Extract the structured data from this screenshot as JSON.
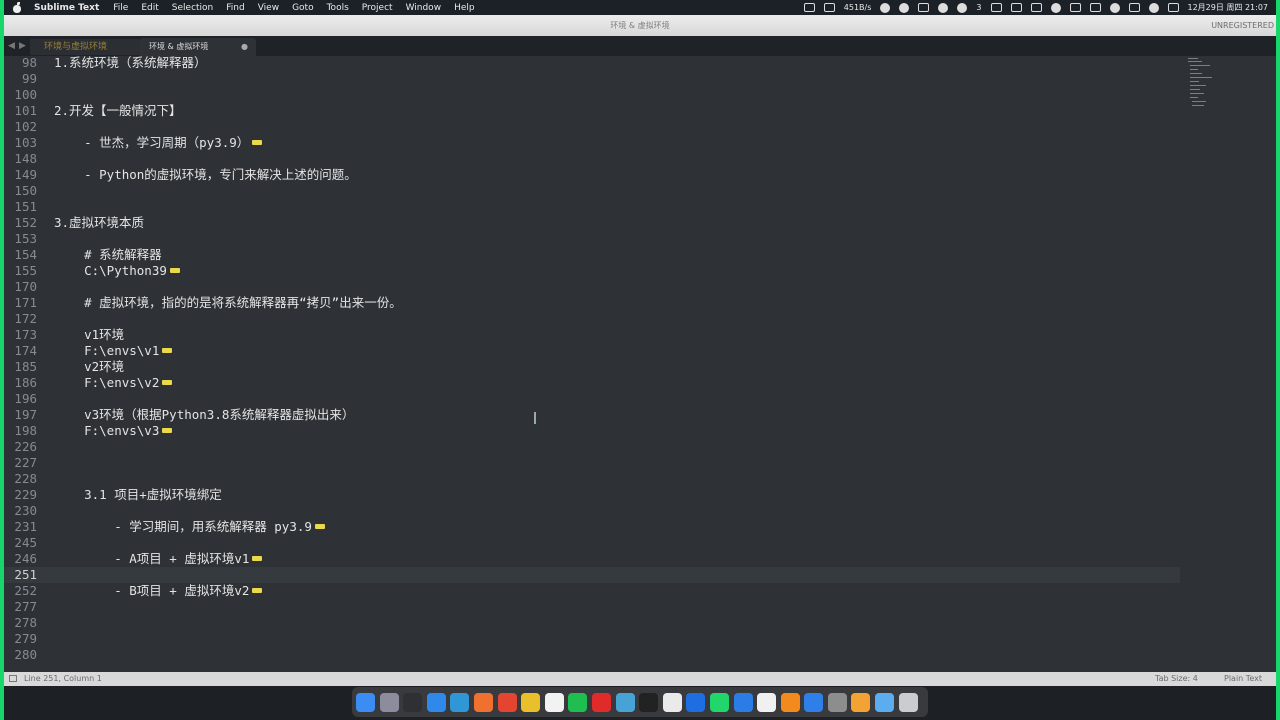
{
  "menubar": {
    "app_name": "Sublime Text",
    "items": [
      "File",
      "Edit",
      "Selection",
      "Find",
      "View",
      "Goto",
      "Tools",
      "Project",
      "Window",
      "Help"
    ],
    "status_speed": "451B/s",
    "badge_count": "3",
    "datetime": "12月29日 周四 21:07"
  },
  "window": {
    "title": "环境 & 虚拟环境",
    "unregistered": "UNREGISTERED"
  },
  "tabs": {
    "ghost_label": "环境与虚拟环境",
    "active_label": "环境 & 虚拟环境",
    "close_glyph": "●"
  },
  "editor": {
    "lines": [
      {
        "n": "98",
        "text": "1.系统环境（系统解释器）"
      },
      {
        "n": "99",
        "text": ""
      },
      {
        "n": "100",
        "text": ""
      },
      {
        "n": "101",
        "text": "2.开发【一般情况下】"
      },
      {
        "n": "102",
        "text": ""
      },
      {
        "n": "103",
        "text": "    - 世杰，学习周期（py3.9）",
        "fold": true
      },
      {
        "n": "148",
        "text": ""
      },
      {
        "n": "149",
        "text": "    - Python的虚拟环境，专门来解决上述的问题。"
      },
      {
        "n": "150",
        "text": ""
      },
      {
        "n": "151",
        "text": ""
      },
      {
        "n": "152",
        "text": "3.虚拟环境本质"
      },
      {
        "n": "153",
        "text": ""
      },
      {
        "n": "154",
        "text": "    # 系统解释器"
      },
      {
        "n": "155",
        "text": "    C:\\Python39",
        "fold": true
      },
      {
        "n": "170",
        "text": ""
      },
      {
        "n": "171",
        "text": "    # 虚拟环境，指的的是将系统解释器再“拷贝”出来一份。"
      },
      {
        "n": "172",
        "text": ""
      },
      {
        "n": "173",
        "text": "    v1环境"
      },
      {
        "n": "174",
        "text": "    F:\\envs\\v1",
        "fold": true
      },
      {
        "n": "185",
        "text": "    v2环境"
      },
      {
        "n": "186",
        "text": "    F:\\envs\\v2",
        "fold": true
      },
      {
        "n": "196",
        "text": ""
      },
      {
        "n": "197",
        "text": "    v3环境（根据Python3.8系统解释器虚拟出来）"
      },
      {
        "n": "198",
        "text": "    F:\\envs\\v3",
        "fold": true
      },
      {
        "n": "226",
        "text": ""
      },
      {
        "n": "227",
        "text": ""
      },
      {
        "n": "228",
        "text": ""
      },
      {
        "n": "229",
        "text": "    3.1 项目+虚拟环境绑定"
      },
      {
        "n": "230",
        "text": ""
      },
      {
        "n": "231",
        "text": "        - 学习期间，用系统解释器 py3.9",
        "fold": true
      },
      {
        "n": "245",
        "text": ""
      },
      {
        "n": "246",
        "text": "        - A项目 + 虚拟环境v1",
        "fold": true
      },
      {
        "n": "251",
        "text": "",
        "current": true
      },
      {
        "n": "252",
        "text": "        - B项目 + 虚拟环境v2",
        "fold": true
      },
      {
        "n": "277",
        "text": ""
      },
      {
        "n": "278",
        "text": ""
      },
      {
        "n": "279",
        "text": ""
      },
      {
        "n": "280",
        "text": ""
      }
    ]
  },
  "status": {
    "position": "Line 251, Column 1",
    "tab_size": "Tab Size: 4",
    "syntax": "Plain Text"
  },
  "dock": {
    "icons": [
      {
        "name": "finder",
        "color": "#3b8cf3"
      },
      {
        "name": "launchpad",
        "color": "#8c8c9e"
      },
      {
        "name": "mission-control",
        "color": "#2f3033"
      },
      {
        "name": "safari",
        "color": "#2e89ea"
      },
      {
        "name": "edge",
        "color": "#2f97d6"
      },
      {
        "name": "firefox",
        "color": "#f0702f"
      },
      {
        "name": "app-red",
        "color": "#e44530"
      },
      {
        "name": "chrome",
        "color": "#e9bf2c"
      },
      {
        "name": "calendar",
        "color": "#f2f2f2"
      },
      {
        "name": "wechat",
        "color": "#1fbe50"
      },
      {
        "name": "netease",
        "color": "#e12a2a"
      },
      {
        "name": "app-blue",
        "color": "#47a2d6"
      },
      {
        "name": "terminal",
        "color": "#222"
      },
      {
        "name": "app-white",
        "color": "#eaeaea"
      },
      {
        "name": "webstorm",
        "color": "#1f6ee1"
      },
      {
        "name": "pycharm",
        "color": "#21d66b"
      },
      {
        "name": "xcode",
        "color": "#2b7de5"
      },
      {
        "name": "typora",
        "color": "#f0f0f0"
      },
      {
        "name": "sublime",
        "color": "#f28a1e"
      },
      {
        "name": "app-cloud",
        "color": "#2e7fe8"
      },
      {
        "name": "app-grey",
        "color": "#8d8d8d"
      },
      {
        "name": "pages",
        "color": "#f3a333"
      },
      {
        "name": "folder",
        "color": "#5cadf0"
      },
      {
        "name": "trash",
        "color": "#c9ccd1"
      }
    ]
  }
}
